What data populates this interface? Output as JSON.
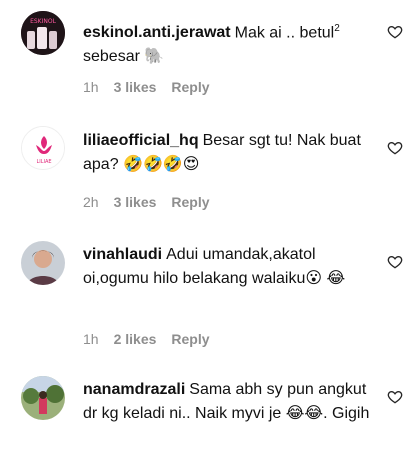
{
  "comments": [
    {
      "username": "eskinol.anti.jerawat",
      "text": "Mak ai .. betul",
      "sup": "2",
      "text2": " sebesar 🐘",
      "time": "1h",
      "likes": "3 likes",
      "reply": "Reply"
    },
    {
      "username": "liliaeofficial_hq",
      "text": "Besar sgt tu! Nak buat apa? 🤣🤣🤣😍",
      "time": "2h",
      "likes": "3 likes",
      "reply": "Reply",
      "avatar_text": "LILIAE"
    },
    {
      "username": "vinahlaudi",
      "text": "Adui umandak,akatol oi,ogumu hilo belakang walaiku😮 😂",
      "time": "1h",
      "likes": "2 likes",
      "reply": "Reply"
    },
    {
      "username": "nanamdrazali",
      "text": "Sama abh sy pun angkut dr kg keladi ni.. Naik myvi je 😂😂. Gigih"
    }
  ],
  "colors": {
    "meta": "#8e8e8e",
    "brand_pink": "#e0287a"
  },
  "icons": [
    "heart-outline-icon"
  ]
}
